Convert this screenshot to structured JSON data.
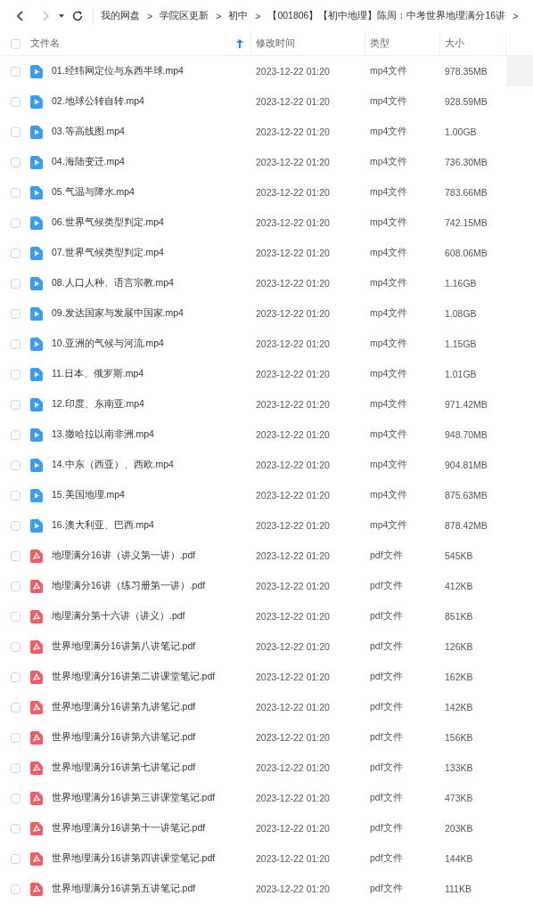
{
  "nav": {
    "back_disabled": false,
    "forward_disabled": true
  },
  "breadcrumbs": [
    "我的网盘",
    "学院区更新",
    "初中",
    "【001806】【初中地理】陈周：中考世界地理满分16讲"
  ],
  "separator": ">",
  "header": {
    "select_all_checked": false,
    "columns": [
      "文件名",
      "修改时间",
      "类型",
      "大小"
    ]
  },
  "rows": [
    {
      "kind": "video",
      "name": "01.经纬网定位与东西半球.mp4",
      "time": "2023-12-22 01:20",
      "type": "mp4文件",
      "size": "978.35MB",
      "checked": false
    },
    {
      "kind": "video",
      "name": "02.地球公转自转.mp4",
      "time": "2023-12-22 01:20",
      "type": "mp4文件",
      "size": "928.59MB",
      "checked": false
    },
    {
      "kind": "video",
      "name": "03.等高线图.mp4",
      "time": "2023-12-22 01:20",
      "type": "mp4文件",
      "size": "1.00GB",
      "checked": false
    },
    {
      "kind": "video",
      "name": "04.海陆变迁.mp4",
      "time": "2023-12-22 01:20",
      "type": "mp4文件",
      "size": "736.30MB",
      "checked": false
    },
    {
      "kind": "video",
      "name": "05.气温与降水.mp4",
      "time": "2023-12-22 01:20",
      "type": "mp4文件",
      "size": "783.66MB",
      "checked": false
    },
    {
      "kind": "video",
      "name": "06.世界气候类型判定.mp4",
      "time": "2023-12-22 01:20",
      "type": "mp4文件",
      "size": "742.15MB",
      "checked": false
    },
    {
      "kind": "video",
      "name": "07.世界气候类型判定.mp4",
      "time": "2023-12-22 01:20",
      "type": "mp4文件",
      "size": "608.06MB",
      "checked": false
    },
    {
      "kind": "video",
      "name": "08.人口人种、语言宗教.mp4",
      "time": "2023-12-22 01:20",
      "type": "mp4文件",
      "size": "1.16GB",
      "checked": false
    },
    {
      "kind": "video",
      "name": "09.发达国家与发展中国家.mp4",
      "time": "2023-12-22 01:20",
      "type": "mp4文件",
      "size": "1.08GB",
      "checked": false
    },
    {
      "kind": "video",
      "name": "10.亚洲的气候与河流.mp4",
      "time": "2023-12-22 01:20",
      "type": "mp4文件",
      "size": "1.15GB",
      "checked": false
    },
    {
      "kind": "video",
      "name": "11.日本、俄罗斯.mp4",
      "time": "2023-12-22 01:20",
      "type": "mp4文件",
      "size": "1.01GB",
      "checked": false
    },
    {
      "kind": "video",
      "name": "12.印度、东南亚.mp4",
      "time": "2023-12-22 01:20",
      "type": "mp4文件",
      "size": "971.42MB",
      "checked": false
    },
    {
      "kind": "video",
      "name": "13.撒哈拉以南非洲.mp4",
      "time": "2023-12-22 01:20",
      "type": "mp4文件",
      "size": "948.70MB",
      "checked": false
    },
    {
      "kind": "video",
      "name": "14.中东（西亚）、西欧.mp4",
      "time": "2023-12-22 01:20",
      "type": "mp4文件",
      "size": "904.81MB",
      "checked": false
    },
    {
      "kind": "video",
      "name": "15.美国地理.mp4",
      "time": "2023-12-22 01:20",
      "type": "mp4文件",
      "size": "875.63MB",
      "checked": false
    },
    {
      "kind": "video",
      "name": "16.澳大利亚、巴西.mp4",
      "time": "2023-12-22 01:20",
      "type": "mp4文件",
      "size": "878.42MB",
      "checked": false
    },
    {
      "kind": "pdf",
      "name": "地理满分16讲（讲义第一讲）.pdf",
      "time": "2023-12-22 01:20",
      "type": "pdf文件",
      "size": "545KB",
      "checked": false
    },
    {
      "kind": "pdf",
      "name": "地理满分16讲（练习册第一讲）.pdf",
      "time": "2023-12-22 01:20",
      "type": "pdf文件",
      "size": "412KB",
      "checked": false
    },
    {
      "kind": "pdf",
      "name": "地理满分第十六讲（讲义）.pdf",
      "time": "2023-12-22 01:20",
      "type": "pdf文件",
      "size": "851KB",
      "checked": false
    },
    {
      "kind": "pdf",
      "name": "世界地理满分16讲第八讲笔记.pdf",
      "time": "2023-12-22 01:20",
      "type": "pdf文件",
      "size": "126KB",
      "checked": false
    },
    {
      "kind": "pdf",
      "name": "世界地理满分16讲第二讲课堂笔记.pdf",
      "time": "2023-12-22 01:20",
      "type": "pdf文件",
      "size": "162KB",
      "checked": false
    },
    {
      "kind": "pdf",
      "name": "世界地理满分16讲第九讲笔记.pdf",
      "time": "2023-12-22 01:20",
      "type": "pdf文件",
      "size": "142KB",
      "checked": false
    },
    {
      "kind": "pdf",
      "name": "世界地理满分16讲第六讲笔记.pdf",
      "time": "2023-12-22 01:20",
      "type": "pdf文件",
      "size": "156KB",
      "checked": false
    },
    {
      "kind": "pdf",
      "name": "世界地理满分16讲第七讲笔记.pdf",
      "time": "2023-12-22 01:20",
      "type": "pdf文件",
      "size": "133KB",
      "checked": false
    },
    {
      "kind": "pdf",
      "name": "世界地理满分16讲第三讲课堂笔记.pdf",
      "time": "2023-12-22 01:20",
      "type": "pdf文件",
      "size": "473KB",
      "checked": false
    },
    {
      "kind": "pdf",
      "name": "世界地理满分16讲第十一讲笔记.pdf",
      "time": "2023-12-22 01:20",
      "type": "pdf文件",
      "size": "203KB",
      "checked": false
    },
    {
      "kind": "pdf",
      "name": "世界地理满分16讲第四讲课堂笔记.pdf",
      "time": "2023-12-22 01:20",
      "type": "pdf文件",
      "size": "144KB",
      "checked": false
    },
    {
      "kind": "pdf",
      "name": "世界地理满分16讲第五讲笔记.pdf",
      "time": "2023-12-22 01:20",
      "type": "pdf文件",
      "size": "111KB",
      "checked": false
    }
  ]
}
